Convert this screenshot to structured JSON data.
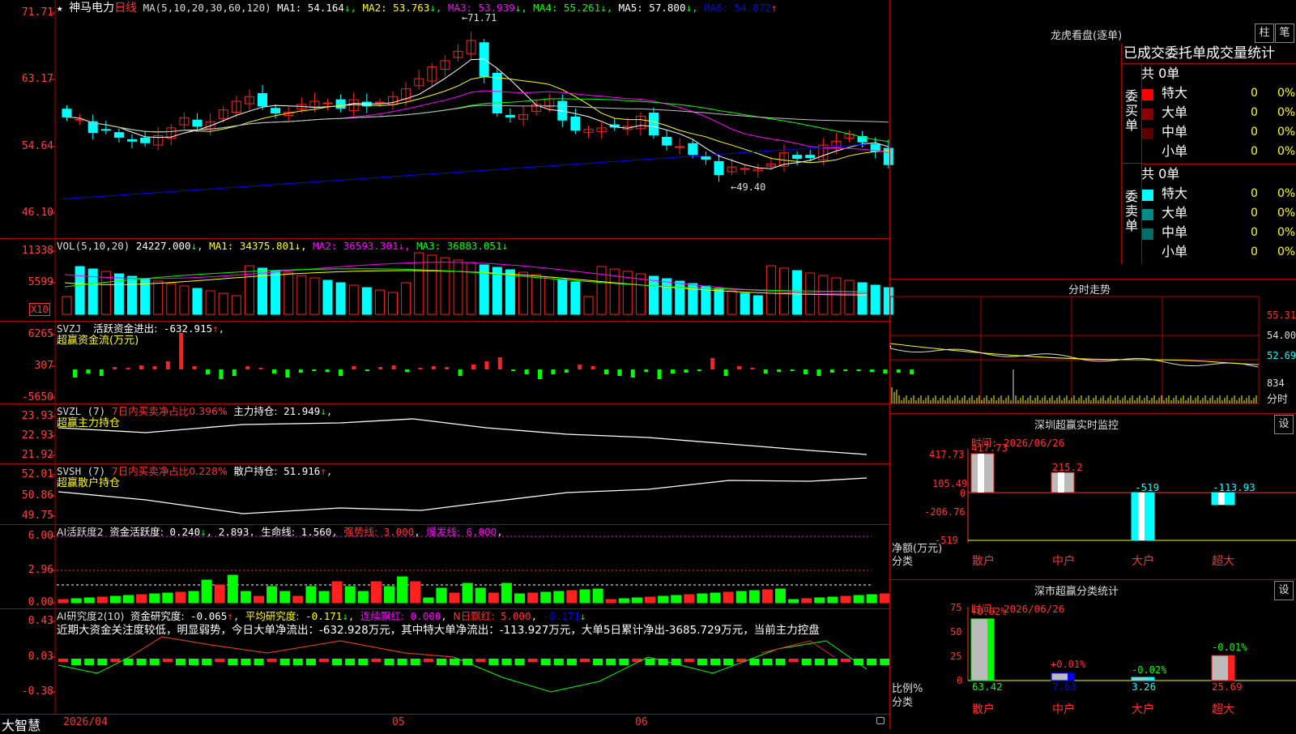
{
  "stock": {
    "name": "神马电力",
    "period": "日线"
  },
  "main_chart": {
    "ma_prefix": "MA(5,10,20,30,60,120)",
    "ma": [
      {
        "label": "MA1:",
        "value": "54.164",
        "arrow": "↓",
        "color": "#ffffff"
      },
      {
        "label": "MA2:",
        "value": "53.763",
        "arrow": "↓",
        "color": "#ffff00"
      },
      {
        "label": "MA3:",
        "value": "53.939",
        "arrow": "↓",
        "color": "#ff00ff"
      },
      {
        "label": "MA4:",
        "value": "55.261",
        "arrow": "↓",
        "color": "#00ff00"
      },
      {
        "label": "MA5:",
        "value": "57.800",
        "arrow": "↓",
        "color": "#ffffff"
      },
      {
        "label": "MA6:",
        "value": "54.872",
        "arrow": "↑",
        "color": "#0000ff"
      }
    ],
    "y_ticks": [
      "71.71",
      "63.17",
      "54.64",
      "46.10"
    ],
    "high_label": "71.71",
    "low_label": "49.40"
  },
  "vol": {
    "prefix": "VOL(5,10,20)",
    "value": "24227.000",
    "arrow": "↓",
    "ma1": "34375.801",
    "ma2": "36593.301",
    "ma3": "36883.051",
    "y_ticks": [
      "11338",
      "5599"
    ],
    "unit": "X10"
  },
  "svzj": {
    "prefix": "SVZJ",
    "label": "活跃资金进出:",
    "value": "-632.915",
    "arrow": "↑",
    "subtitle": "超赢资金流(万元)",
    "y_ticks": [
      "6265",
      "307",
      "-5650"
    ]
  },
  "svzl": {
    "prefix": "SVZL (7)",
    "ratio_label": "7日内买卖净占比0.396%",
    "hold_label": "主力持仓:",
    "hold_value": "21.949",
    "arrow": "↓",
    "subtitle": "超赢主力持仓",
    "y_ticks": [
      "23.93",
      "22.93",
      "21.92"
    ]
  },
  "svsh": {
    "prefix": "SVSH (7)",
    "ratio_label": "7日内买卖净占比0.228%",
    "hold_label": "散户持仓:",
    "hold_value": "51.916",
    "arrow": "↑",
    "subtitle": "超赢散户持仓",
    "y_ticks": [
      "52.01",
      "50.86",
      "49.75"
    ]
  },
  "ai_active": {
    "prefix": "AI活跃度2",
    "label": "资金活跃度:",
    "value": "0.240",
    "arrow": "↓",
    "v2": "2.893",
    "life_label": "生命线:",
    "life": "1.560",
    "strong_label": "强势线:",
    "strong": "3.000",
    "burst_label": "爆发线:",
    "burst": "6.000",
    "y_ticks": [
      "6.00",
      "2.96",
      "0.00"
    ]
  },
  "ai_research": {
    "prefix": "AI研究度2(10)",
    "label": "资金研究度:",
    "value": "-0.065",
    "arrow": "↑",
    "avg_label": "平均研究度:",
    "avg": "-0.171",
    "avg_arrow": "↓",
    "cont_label": "连续飘红:",
    "cont": "0.000",
    "n_label": "N日飘红:",
    "n": "5.000",
    "last": "-0.171",
    "commentary": "近期大资金关注度较低，明显弱势，今日大单净流出：-632.928万元，其中特大单净流出：-113.927万元，大单5日累计净出-3685.729万元，当前主力控盘",
    "y_ticks": [
      "0.43",
      "0.03",
      "-0.38"
    ]
  },
  "time_axis": {
    "brand": "大智慧",
    "labels": [
      "2026/04",
      "05",
      "06"
    ]
  },
  "longhu": {
    "title": "龙虎看盘(逐单)",
    "btn_bar": "柱",
    "btn_bi": "笔",
    "tabs": "已成交委托单成交量统计",
    "buy": {
      "side": "委买单",
      "total": "共 0单",
      "rows": [
        {
          "label": "特大",
          "v": "0",
          "p": "0%",
          "color": "#ff0000"
        },
        {
          "label": "大单",
          "v": "0",
          "p": "0%",
          "color": "#8b0000"
        },
        {
          "label": "中单",
          "v": "0",
          "p": "0%",
          "color": "#5a0000"
        },
        {
          "label": "小单",
          "v": "0",
          "p": "0%",
          "color": ""
        }
      ]
    },
    "sell": {
      "side": "委卖单",
      "total": "共 0单",
      "rows": [
        {
          "label": "特大",
          "v": "0",
          "p": "0%",
          "color": "#00ffff"
        },
        {
          "label": "大单",
          "v": "0",
          "p": "0%",
          "color": "#008b8b"
        },
        {
          "label": "中单",
          "v": "0",
          "p": "0%",
          "color": "#006d6d"
        },
        {
          "label": "小单",
          "v": "0",
          "p": "0%",
          "color": ""
        }
      ]
    }
  },
  "intraday": {
    "title": "分时走势",
    "y_ticks": [
      "55.31",
      "54.00",
      "52.69"
    ],
    "vol_tick": "834",
    "unit": "分时"
  },
  "sz_monitor": {
    "title": "深圳超赢实时监控",
    "btn": "设",
    "time": "时间: 2026/06/26",
    "y_ticks": [
      "417.73",
      "105.49",
      "0",
      "-206.76",
      "-519"
    ],
    "y_label": "净额(万元)",
    "x_label": "分类",
    "categories": [
      "散户",
      "中户",
      "大户",
      "超大"
    ],
    "values": [
      "417.73",
      "215.2",
      "-519",
      "-113.93"
    ]
  },
  "sz_class": {
    "title": "深市超赢分类统计",
    "btn": "设",
    "time": "时间: 2026/06/26",
    "y_ticks": [
      "75",
      "50",
      "25",
      "0"
    ],
    "y_label": "比例%",
    "x_label": "分类",
    "categories": [
      "散户",
      "中户",
      "大户",
      "超大"
    ],
    "changes": [
      "+0.02%",
      "+0.01%",
      "-0.02%",
      "-0.01%"
    ],
    "values": [
      "63.42",
      "7.63",
      "3.26",
      "25.69"
    ]
  },
  "chart_data": [
    {
      "type": "candlestick",
      "title": "神马电力 日线",
      "ylim": [
        46.1,
        71.71
      ],
      "high": 71.71,
      "low": 49.4,
      "close": [
        58.4,
        58.1,
        56.4,
        56.7,
        55.8,
        55.3,
        55.1,
        56.0,
        57.0,
        58.3,
        57.2,
        57.8,
        59.3,
        60.4,
        61.0,
        59.8,
        58.9,
        59.0,
        60.0,
        60.4,
        60.2,
        59.5,
        60.6,
        59.8,
        60.3,
        61.0,
        62.0,
        63.3,
        64.8,
        65.6,
        66.8,
        68.2,
        63.6,
        58.9,
        58.4,
        58.7,
        60.0,
        60.7,
        58.0,
        56.7,
        56.8,
        57.0,
        57.1,
        57.2,
        58.5,
        56.1,
        54.8,
        54.6,
        53.6,
        53.0,
        51.0,
        52.0,
        51.8,
        51.7,
        52.4,
        53.8,
        53.1,
        53.2,
        54.8,
        55.3,
        56.2,
        55.2,
        54.0,
        52.3
      ]
    }
  ]
}
